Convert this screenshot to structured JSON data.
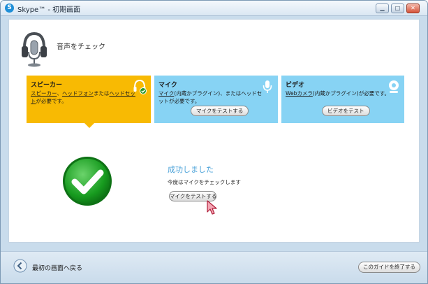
{
  "window": {
    "title": "Skype™ - 初期画面"
  },
  "header": {
    "title": "音声をチェック",
    "icon": "headset-icon"
  },
  "cards": {
    "speaker": {
      "title": "スピーカー",
      "desc_link1": "スピーカー",
      "desc_sep": "、",
      "desc_link2": "ヘッドフォン",
      "desc_mid": "または",
      "desc_link3": "ヘッドセット",
      "desc_end": "が必要です。",
      "icon": "headphones-check-icon",
      "color": "#f8ba03"
    },
    "mic": {
      "title": "マイク",
      "desc_link": "マイク",
      "desc_rest": "(内蔵かプラグイン)、またはヘッドセットが必要です。",
      "button": "マイクをテストする",
      "icon": "microphone-icon",
      "color": "#87d3f4"
    },
    "video": {
      "title": "ビデオ",
      "desc_link": "Webカメラ",
      "desc_rest": "(内蔵かプラグイン)が必要です。",
      "button": "ビデオをテスト",
      "icon": "webcam-icon",
      "color": "#87d3f4"
    }
  },
  "result": {
    "title": "成功しました",
    "subtitle": "今度はマイクをチェックします",
    "button": "マイクをテストする",
    "icon": "success-check-icon"
  },
  "footer": {
    "back_label": "最初の画面へ戻る",
    "end_button": "このガイドを終了する"
  }
}
